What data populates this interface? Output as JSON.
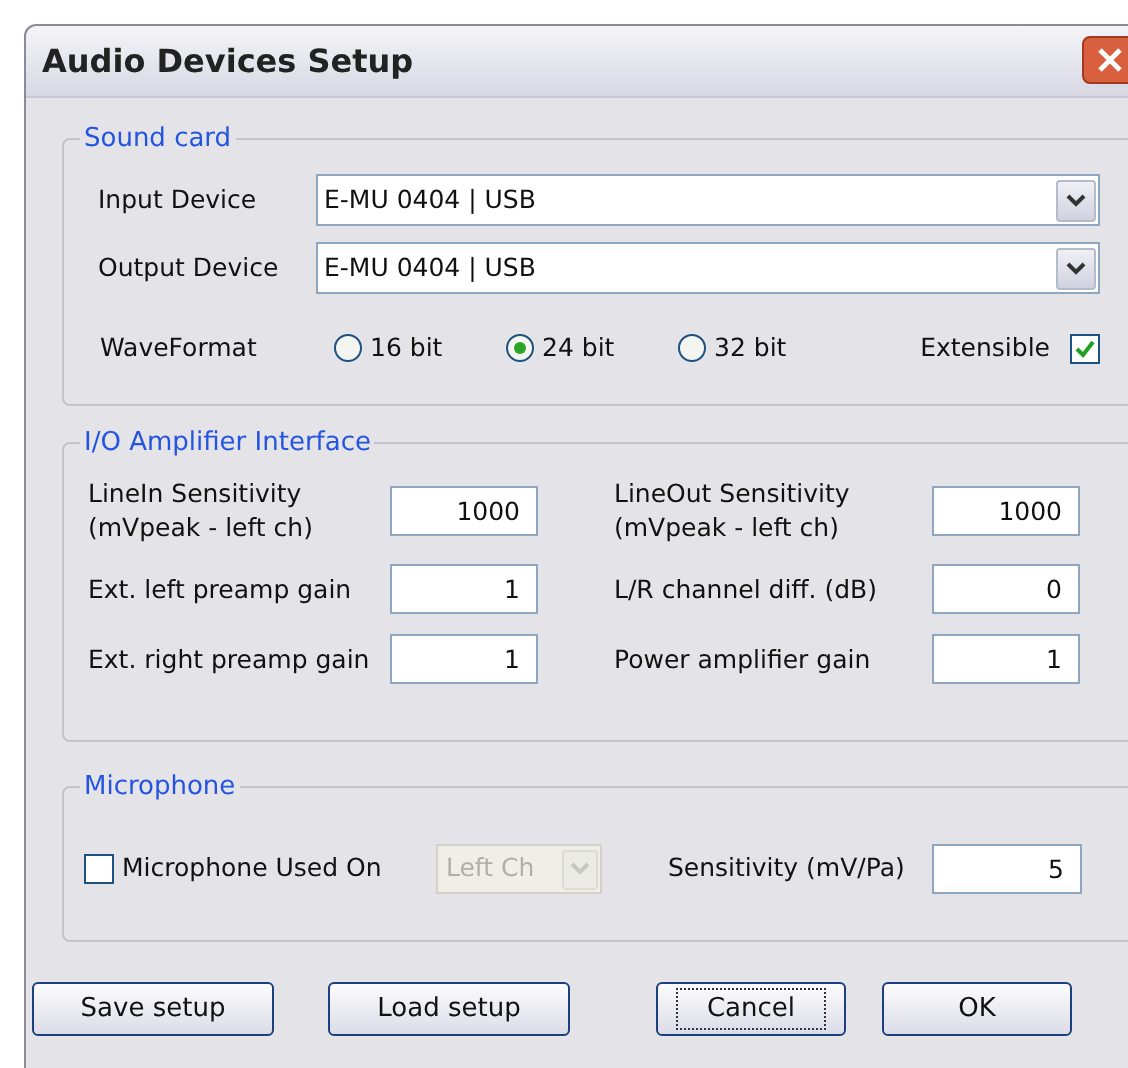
{
  "window": {
    "title": "Audio Devices Setup"
  },
  "sound_card": {
    "title": "Sound card",
    "devices": [
      {
        "label": "Input Device",
        "value": "E-MU 0404 | USB"
      },
      {
        "label": "Output Device",
        "value": "E-MU 0404 | USB"
      }
    ],
    "wave_format": {
      "label": "WaveFormat",
      "options": [
        {
          "label": "16 bit",
          "selected": false
        },
        {
          "label": "24 bit",
          "selected": true
        },
        {
          "label": "32 bit",
          "selected": false
        }
      ]
    },
    "extensible": {
      "label": "Extensible",
      "checked": true
    }
  },
  "io_amplifier": {
    "title": "I/O Amplifier Interface",
    "fields": [
      {
        "label": "LineIn Sensitivity (mVpeak - left ch)",
        "value": "1000"
      },
      {
        "label": "LineOut Sensitivity (mVpeak - left ch)",
        "value": "1000"
      },
      {
        "label": "Ext. left preamp gain",
        "value": "1"
      },
      {
        "label": "L/R channel diff. (dB)",
        "value": "0"
      },
      {
        "label": "Ext. right preamp gain",
        "value": "1"
      },
      {
        "label": "Power amplifier gain",
        "value": "1"
      }
    ]
  },
  "microphone": {
    "title": "Microphone",
    "used_on": {
      "label": "Microphone Used On",
      "checked": false
    },
    "channel": {
      "value": "Left Ch",
      "disabled": true
    },
    "sensitivity": {
      "label": "Sensitivity (mV/Pa)",
      "value": "5"
    }
  },
  "buttons": [
    {
      "label": "Save setup",
      "focused": false
    },
    {
      "label": "Load setup",
      "focused": false
    },
    {
      "label": "Cancel",
      "focused": true
    },
    {
      "label": "OK",
      "focused": false
    }
  ]
}
